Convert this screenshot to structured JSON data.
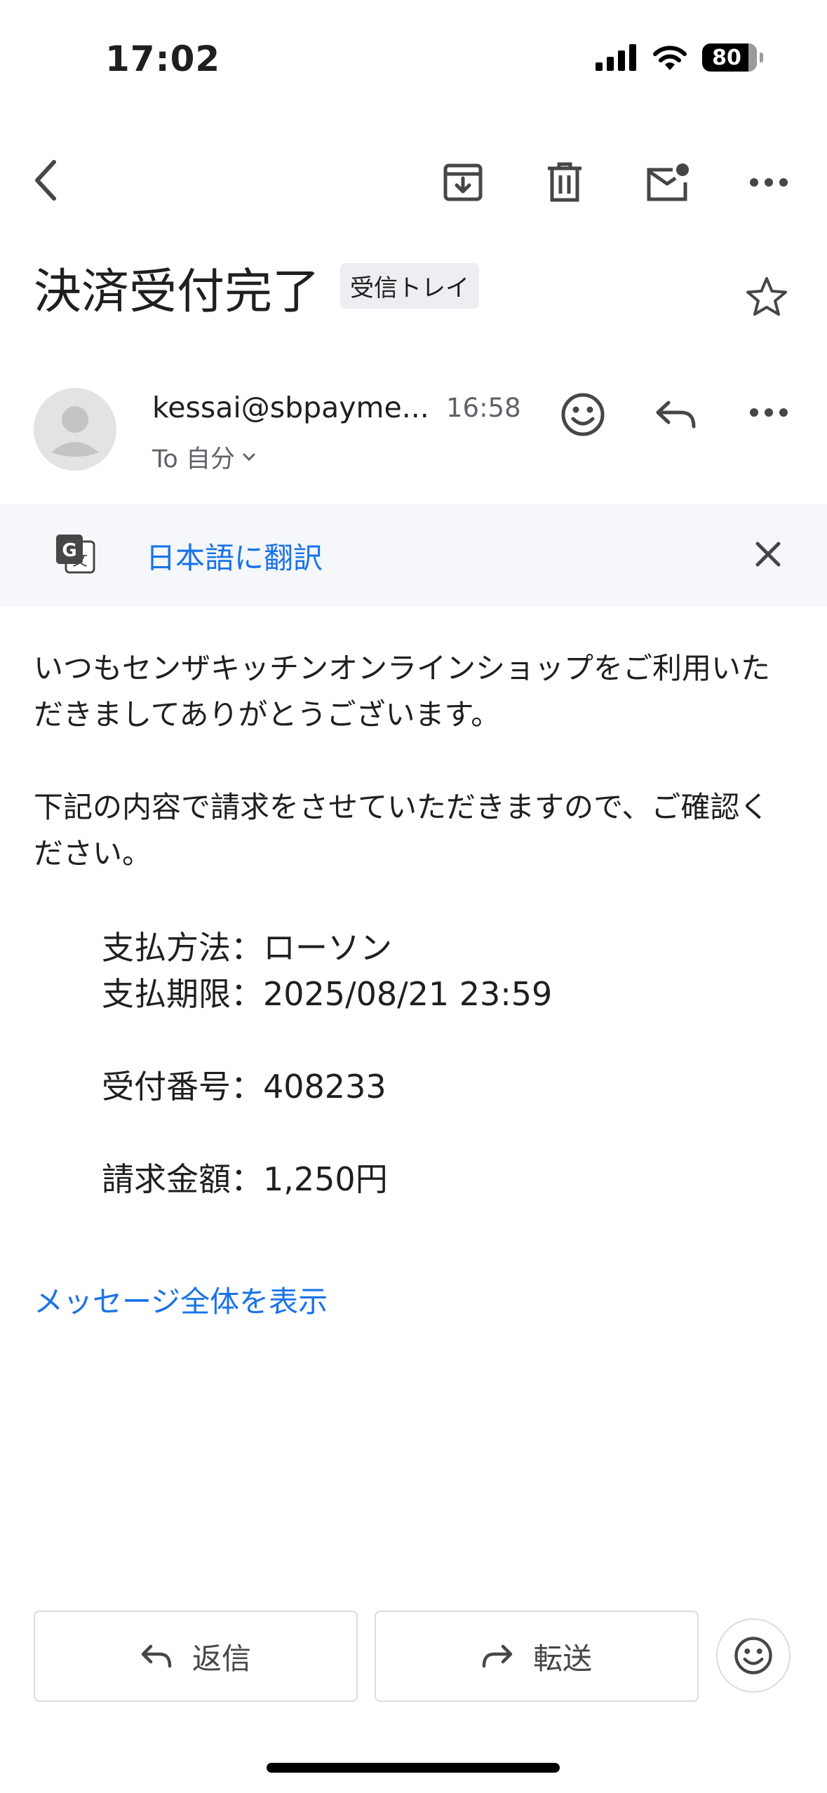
{
  "status_bar": {
    "time": "17:02",
    "battery": "80"
  },
  "toolbar": {
    "back": "back",
    "archive": "archive",
    "delete": "delete",
    "mark_unread": "mark-unread",
    "more": "more"
  },
  "email": {
    "subject": "決済受付完了",
    "label": "受信トレイ",
    "sender": "kessai@sbpayme...",
    "time": "16:58",
    "to": "To 自分"
  },
  "translate": {
    "label": "日本語に翻訳"
  },
  "body": {
    "para1": "いつもセンザキッチンオンラインショップをご利用いただきましてありがとうございます。",
    "para2": "下記の内容で請求をさせていただきますので、ご確認ください。",
    "payment_method": "支払方法：ローソン",
    "payment_deadline": "支払期限：2025/08/21 23:59",
    "receipt_number": "受付番号：408233",
    "amount": "請求金額：1,250円"
  },
  "show_full": "メッセージ全体を表示",
  "actions": {
    "reply": "返信",
    "forward": "転送"
  },
  "colors": {
    "link": "#1a73e8",
    "icon": "#444746"
  }
}
